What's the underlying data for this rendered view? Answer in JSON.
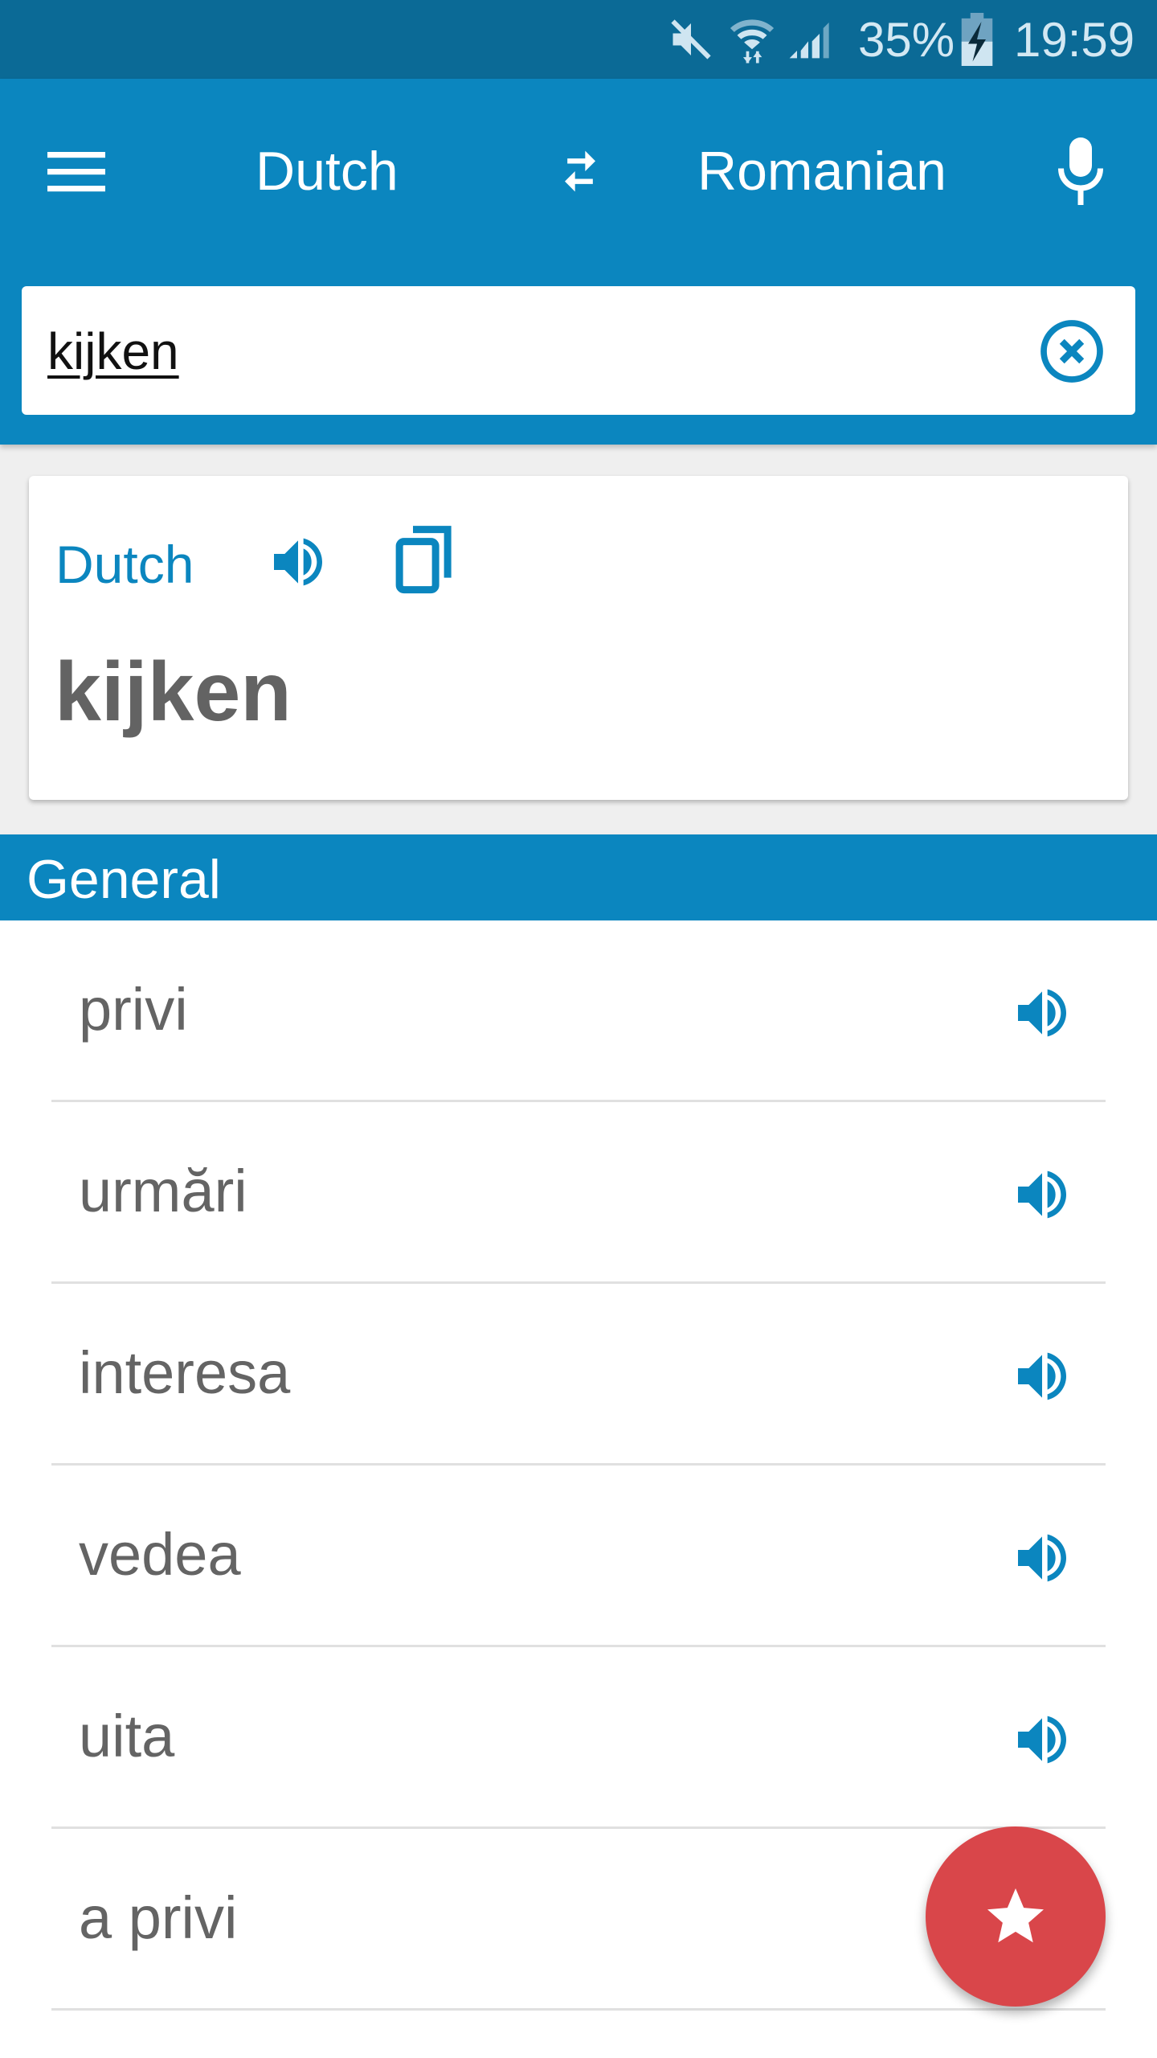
{
  "status_bar": {
    "icons": [
      "mute-icon",
      "wifi-icon",
      "signal-icon",
      "battery-charging-icon"
    ],
    "battery": "35%",
    "time": "19:59"
  },
  "appbar": {
    "menu_icon": "hamburger-menu-icon",
    "source_language": "Dutch",
    "swap_icon": "swap-arrows-icon",
    "target_language": "Romanian",
    "mic_icon": "microphone-icon"
  },
  "search": {
    "value": "kijken",
    "clear_icon": "clear-circle-icon"
  },
  "source_card": {
    "language": "Dutch",
    "speak_icon": "speaker-icon",
    "copy_icon": "copy-icon",
    "word": "kijken"
  },
  "section": {
    "title": "General"
  },
  "translations": [
    {
      "word": "privi"
    },
    {
      "word": "urmări"
    },
    {
      "word": "interesa"
    },
    {
      "word": "vedea"
    },
    {
      "word": "uita"
    },
    {
      "word": "a privi"
    }
  ],
  "fab": {
    "icon": "star-icon"
  },
  "colors": {
    "primary": "#0b86bf",
    "status_bar": "#0b6a96",
    "fab": "#d9464a",
    "text_gray": "#646464"
  }
}
